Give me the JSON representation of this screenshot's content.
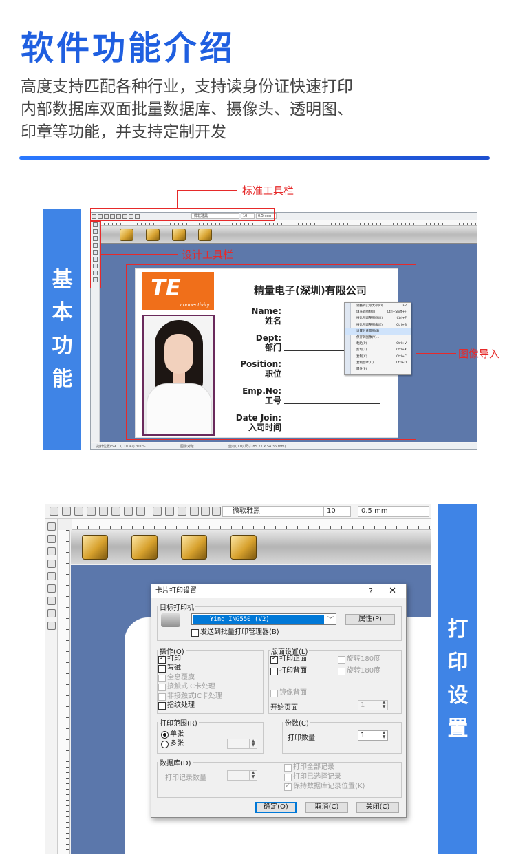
{
  "header": {
    "title": "软件功能介绍",
    "desc_lines": [
      "高度支持匹配各种行业，支持读身份证快速打印",
      "内部数据库双面批量数据库、摄像头、透明图、",
      "印章等功能，并支持定制开发"
    ]
  },
  "section1": {
    "label_chars": [
      "基",
      "本",
      "功",
      "能"
    ],
    "annotations": {
      "toolbar": "标准工具栏",
      "design": "设计工具栏",
      "image": "图像导入"
    },
    "toolbar": {
      "font": "微软雅黑",
      "size": "10",
      "stroke": "0.5 mm"
    },
    "status": {
      "left": "指针位置(59.13, 10.92) 300%",
      "mid": "图像对象",
      "right": "坐标(0.0) 尺寸(85.77 x 54.36 mm)"
    },
    "card": {
      "logo": "TE",
      "logo_sub": "connectivity",
      "company": "精量电子(深圳)有限公司",
      "fields": [
        {
          "en": "Name:",
          "cn": "姓名"
        },
        {
          "en": "Dept:",
          "cn": "部门"
        },
        {
          "en": "Position:",
          "cn": "职位"
        },
        {
          "en": "Emp.No:",
          "cn": "工号"
        },
        {
          "en": "Date Join:",
          "cn": "入司时间"
        }
      ]
    },
    "context_menu": [
      {
        "label": "调整到实际大小(O)",
        "key": "F2"
      },
      {
        "label": "填充到图框(I)",
        "key": "Ctrl+Shift+F"
      },
      {
        "label": "按比例调整图框(R)",
        "key": "Ctrl+F"
      },
      {
        "label": "按比例调整图像(E)",
        "key": "Ctrl+B"
      },
      {
        "label": "设置为背景图(S)",
        "key": ""
      },
      {
        "label": "保存到图像(V)...",
        "key": ""
      },
      {
        "label": "粘贴(P)",
        "key": "Ctrl+V"
      },
      {
        "label": "剪切(T)",
        "key": "Ctrl+X"
      },
      {
        "label": "复制(C)",
        "key": "Ctrl+C"
      },
      {
        "label": "复制副本(D)",
        "key": "Ctrl+D"
      },
      {
        "label": "属性(P)",
        "key": ""
      }
    ]
  },
  "section2": {
    "label_chars": [
      "打",
      "印",
      "设",
      "置"
    ],
    "toolbar": {
      "font": "微软雅黑",
      "size": "10",
      "stroke": "0.5 mm"
    },
    "dialog": {
      "title": "卡片打印设置",
      "help": "?",
      "close": "✕",
      "target_printer_label": "目标打印机",
      "printer": "Ying ING550 (V2)",
      "props_button": "属性(P)",
      "send_batch": "发送到批量打印管理器(B)",
      "ops": {
        "label": "操作(O)",
        "items": [
          {
            "text": "打印",
            "checked": true,
            "disabled": false
          },
          {
            "text": "写磁",
            "checked": false,
            "disabled": false
          },
          {
            "text": "全息覆膜",
            "checked": false,
            "disabled": true
          },
          {
            "text": "接触式IC卡处理",
            "checked": false,
            "disabled": true
          },
          {
            "text": "非接触式IC卡处理",
            "checked": false,
            "disabled": true
          },
          {
            "text": "指纹处理",
            "checked": false,
            "disabled": false
          }
        ]
      },
      "layout": {
        "label": "版面设置(L)",
        "print_front": "打印正面",
        "print_back": "打印背面",
        "rotate1": "旋转180度",
        "rotate2": "旋转180度",
        "mirror_back": "镜像背面",
        "start_page_label": "开始页面",
        "start_page": "1"
      },
      "range": {
        "label": "打印范围(R)",
        "single": "单张",
        "multi": "多张"
      },
      "copies": {
        "label": "份数(C)",
        "qty_label": "打印数量",
        "qty": "1"
      },
      "database": {
        "label": "数据库(D)",
        "record_count_label": "打印记录数量",
        "print_all": "打印全部记录",
        "print_selected": "打印已选择记录",
        "keep_position": "保持数据库记录位置(K)"
      },
      "buttons": {
        "ok": "确定(O)",
        "cancel": "取消(C)",
        "close": "关闭(C)"
      }
    }
  }
}
